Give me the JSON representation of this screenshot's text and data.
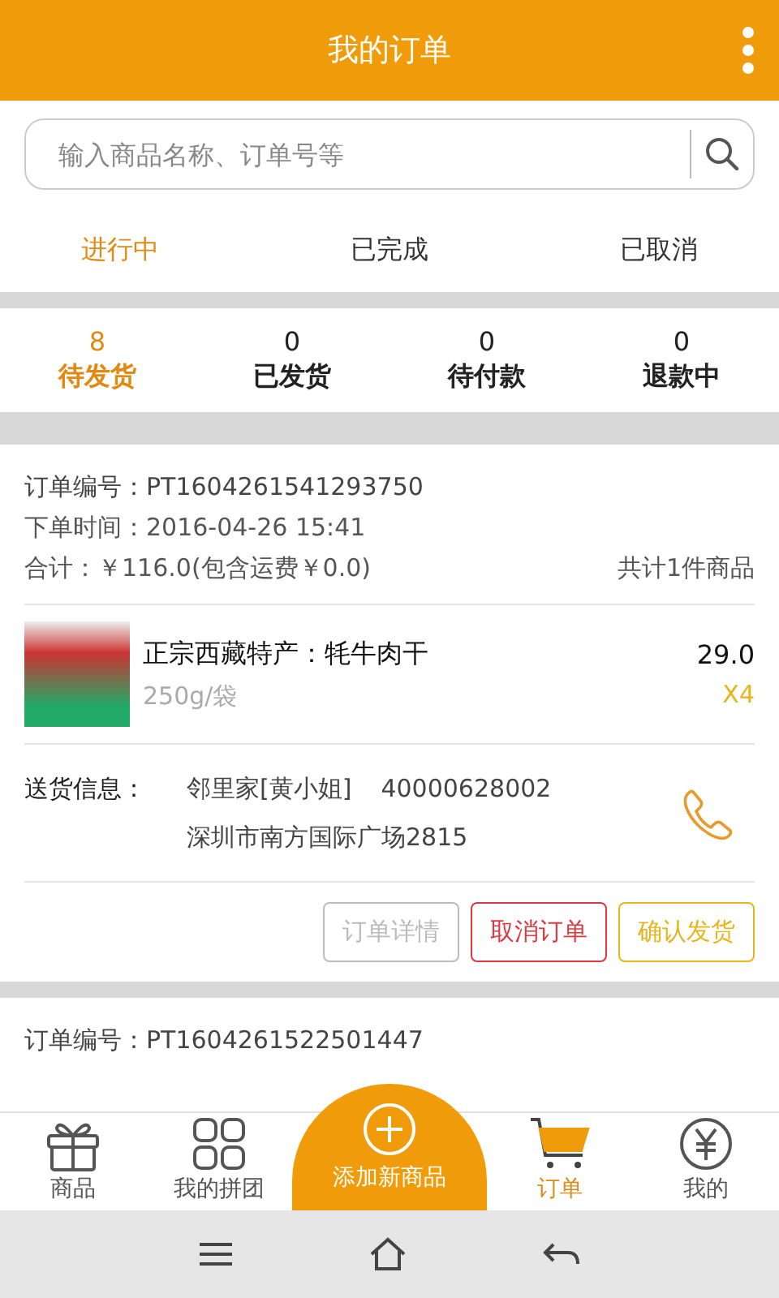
{
  "header": {
    "title": "我的订单"
  },
  "search": {
    "placeholder": "输入商品名称、订单号等"
  },
  "tabs": [
    {
      "label": "进行中",
      "selected": true
    },
    {
      "label": "已完成",
      "selected": false
    },
    {
      "label": "已取消",
      "selected": false
    }
  ],
  "status_counts": [
    {
      "count": "8",
      "label": "待发货",
      "selected": true
    },
    {
      "count": "0",
      "label": "已发货",
      "selected": false
    },
    {
      "count": "0",
      "label": "待付款",
      "selected": false
    },
    {
      "count": "0",
      "label": "退款中",
      "selected": false
    }
  ],
  "orders": [
    {
      "number_label": "订单编号：",
      "number": "PT1604261541293750",
      "time_label": "下单时间：",
      "time": "2016-04-26 15:41",
      "total_label": "合计：",
      "total": "￥116.0(包含运费￥0.0)",
      "item_count": "共计1件商品",
      "items": [
        {
          "name": "正宗西藏特产：牦牛肉干",
          "spec": "250g/袋",
          "price": "29.0",
          "quantity": "X4"
        }
      ],
      "delivery_label": "送货信息：",
      "recipient": "邻里家[黄小姐]",
      "phone": "40000628002",
      "address": "深圳市南方国际广场2815",
      "actions": [
        {
          "label": "订单详情",
          "color": "#bbbbbb"
        },
        {
          "label": "取消订单",
          "color": "#e0383e"
        },
        {
          "label": "确认发货",
          "color": "#e8b418"
        }
      ]
    },
    {
      "number_label": "订单编号：",
      "number": "PT1604261522501447"
    }
  ],
  "bottom_nav": [
    {
      "kind": "tab",
      "label": "商品",
      "selected": false
    },
    {
      "kind": "tab",
      "label": "我的拼团",
      "selected": false
    },
    {
      "kind": "add",
      "label": "添加新商品"
    },
    {
      "kind": "tab",
      "label": "订单",
      "selected": true
    },
    {
      "kind": "tab",
      "label": "我的",
      "selected": false
    }
  ]
}
